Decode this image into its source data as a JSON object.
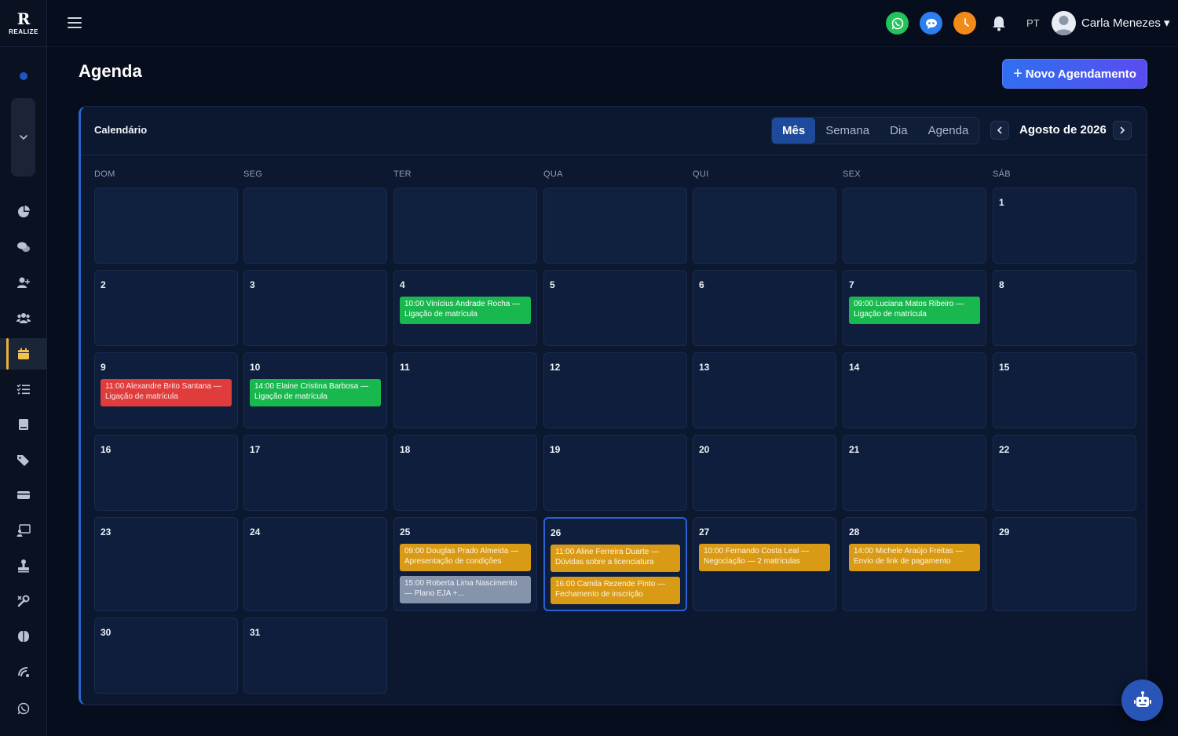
{
  "app": {
    "logo_mark": "R",
    "logo_text": "REALIZE"
  },
  "topbar": {
    "lang": "PT",
    "user_name": "Carla Menezes ▾"
  },
  "page": {
    "title": "Agenda",
    "new_button": "Novo Agendamento",
    "new_button_plus": "+"
  },
  "calendar": {
    "card_title": "Calendário",
    "views": [
      "Mês",
      "Semana",
      "Dia",
      "Agenda"
    ],
    "active_view": "Mês",
    "month_label": "Agosto de 2026",
    "days_of_week": [
      "DOM",
      "SEG",
      "TER",
      "QUA",
      "QUI",
      "SEX",
      "SÁB"
    ],
    "weeks": [
      [
        "",
        "",
        "",
        "",
        "",
        "",
        "1"
      ],
      [
        "2",
        "3",
        "4",
        "5",
        "6",
        "7",
        "8"
      ],
      [
        "9",
        "10",
        "11",
        "12",
        "13",
        "14",
        "15"
      ],
      [
        "16",
        "17",
        "18",
        "19",
        "20",
        "21",
        "22"
      ],
      [
        "23",
        "24",
        "25",
        "26",
        "27",
        "28",
        "29"
      ],
      [
        "30",
        "31"
      ]
    ],
    "today": "26",
    "events": [
      {
        "day": "4",
        "text": "10:00 Vinícius Andrade Rocha — Ligação de matrícula",
        "color": "green"
      },
      {
        "day": "7",
        "text": "09:00 Luciana Matos Ribeiro — Ligação de matrícula",
        "color": "green"
      },
      {
        "day": "9",
        "text": "11:00 Alexandre Brito Santana — Ligação de matrícula",
        "color": "red"
      },
      {
        "day": "10",
        "text": "14:00 Elaine Cristina Barbosa — Ligação de matrícula",
        "color": "green"
      },
      {
        "day": "25",
        "text": "09:00 Douglas Prado Almeida — Apresentação de condições",
        "color": "yellow"
      },
      {
        "day": "25",
        "text": "15:00 Roberta Lima Nascimento — Plano EJA +...",
        "color": "gray"
      },
      {
        "day": "26",
        "text": "11:00 Aline Ferreira Duarte — Dúvidas sobre a licenciatura",
        "color": "yellow"
      },
      {
        "day": "26",
        "text": "16:00 Camila Rezende Pinto — Fechamento de inscrição",
        "color": "yellow"
      },
      {
        "day": "27",
        "text": "10:00 Fernando Costa Leal — Negociação — 2 matrículas",
        "color": "yellow"
      },
      {
        "day": "28",
        "text": "14:00 Michele Araújo Freitas — Envio de link de pagamento",
        "color": "yellow"
      }
    ]
  },
  "colors": {
    "accent": "#2f6ff0",
    "event_green": "#19b84f",
    "event_red": "#e03c3c",
    "event_yellow": "#d99a16",
    "event_gray": "#8593ab",
    "active_nav": "#e8b23a"
  },
  "icons": {
    "sidebar": [
      "dashboard-icon",
      "chat-icon",
      "add-user-icon",
      "users-icon",
      "calendar-icon",
      "tasks-icon",
      "book-icon",
      "tags-icon",
      "card-icon",
      "monitor-icon",
      "stamp-icon",
      "settings-icon",
      "brain-icon",
      "support-icon",
      "whatsapp-icon"
    ],
    "topbar": [
      "menu-icon",
      "whatsapp-icon",
      "chatbot-icon",
      "clock-icon",
      "bell-icon",
      "avatar"
    ]
  }
}
